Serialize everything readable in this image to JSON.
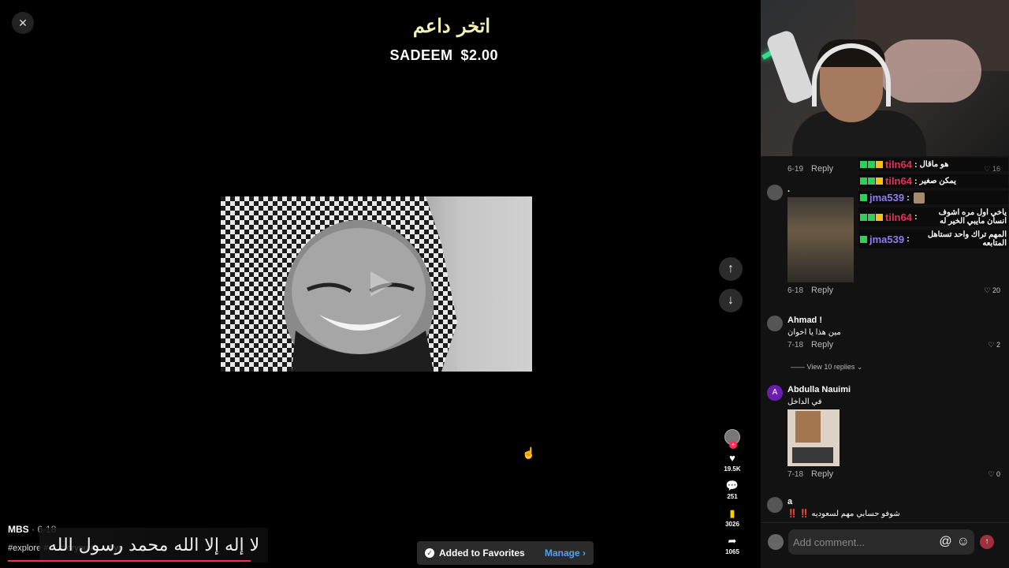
{
  "video": {
    "overlay_title": "اتخر داعم",
    "donation_name": "SADEEM",
    "donation_amount": "$2.00",
    "author": "MBS",
    "date": "· 6-18",
    "hashtags": "#explore #…  #foryou #… #fyp",
    "banner_text": "لا إله إلا الله محمد رسول الله"
  },
  "actions": {
    "likes": "19.5K",
    "comments": "251",
    "saves": "3026",
    "shares": "1065"
  },
  "toast": {
    "message": "Added to Favorites",
    "manage_label": "Manage"
  },
  "comments": [
    {
      "date": "6-19",
      "reply": "Reply",
      "likes": "16"
    },
    {
      "name": ".",
      "date": "6-18",
      "reply": "Reply",
      "likes": "20"
    },
    {
      "name": "Ahmad !",
      "text": "مين هذا يا اخوان",
      "date": "7-18",
      "reply": "Reply",
      "likes": "2"
    },
    {
      "name": "Abdulla Nauimi",
      "avatar_letter": "A",
      "text": "في الداخل",
      "date": "7-18",
      "reply": "Reply",
      "likes": "0"
    },
    {
      "name": "a",
      "text": "شوفو حسابي مهم لسعوديه ‼️ ‼️"
    }
  ],
  "view_replies": "View 10 replies",
  "chat": [
    {
      "user": "tiln64",
      "text": "هو ماقال",
      "color": "#e0325a"
    },
    {
      "user": "tiln64",
      "text": "يمكن صغير",
      "color": "#e0325a"
    },
    {
      "user": "jma539",
      "text": "",
      "color": "#8e7cf0"
    },
    {
      "user": "tiln64",
      "text": "ياخي اول مره اشوف انسان مايبي الخير له",
      "color": "#e0325a"
    },
    {
      "user": "jma539",
      "text": "المهم تراك واحد تستاهل المتابعه",
      "color": "#8e7cf0"
    }
  ],
  "composer": {
    "placeholder": "Add comment..."
  },
  "icons": {
    "close": "close-icon",
    "up": "arrow-up-icon",
    "down": "arrow-down-icon",
    "heart": "heart-icon",
    "comment": "comment-icon",
    "bookmark": "bookmark-icon",
    "share": "share-icon",
    "mention": "at-icon",
    "emoji": "emoji-icon",
    "send": "send-icon"
  },
  "colors": {
    "accent": "#fe2c55",
    "link": "#4aa3ff",
    "bookmark": "#ffcc00"
  }
}
